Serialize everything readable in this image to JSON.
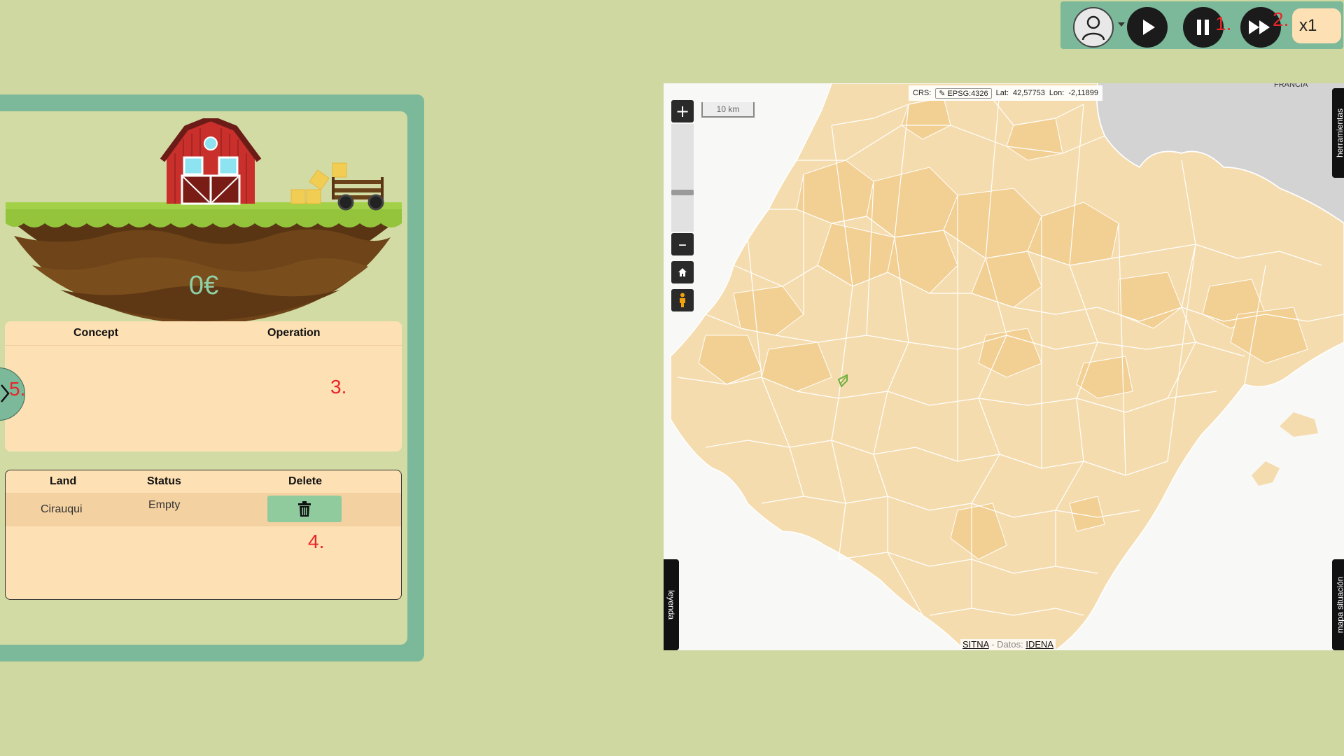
{
  "toolbar": {
    "speed": "x1",
    "pause_marker": "1.",
    "fast_forward_marker": "2."
  },
  "farm": {
    "money": "0€"
  },
  "operations_table": {
    "headers": [
      "Concept",
      "Operation"
    ],
    "marker": "3."
  },
  "lands_table": {
    "headers": [
      "Land",
      "Status",
      "Delete"
    ],
    "rows": [
      {
        "land": "Cirauqui",
        "status": "Empty"
      }
    ],
    "marker": "4."
  },
  "side_panel": {
    "marker": "5."
  },
  "map": {
    "scale": "10 km",
    "crs_label": "CRS:",
    "crs_value": "✎ EPSG:4326",
    "lat_label": "Lat:",
    "lat_value": "42,57753",
    "lon_label": "Lon:",
    "lon_value": "-2,11899",
    "country_label": "FRANCIA",
    "tools_tab": "herramientas",
    "legend_tab": "leyenda",
    "overview_tab": "mapa situación",
    "attribution_source": "SITNA",
    "attribution_sep": "- Datos:",
    "attribution_data": "IDENA",
    "colors": {
      "land": "#f5dcae",
      "land_dark": "#f2cf92",
      "border": "#ffffff",
      "france": "#d3d3d3"
    }
  },
  "icons": [
    "user-icon",
    "play-icon",
    "pause-icon",
    "fast-forward-icon",
    "trash-icon",
    "home-icon",
    "pegman-icon",
    "chevron-right-icon"
  ]
}
